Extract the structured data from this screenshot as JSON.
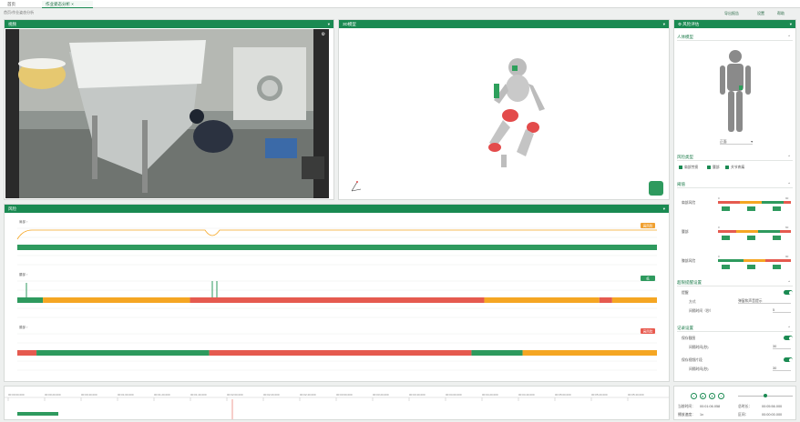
{
  "tabs": [
    {
      "label": "首页",
      "active": false
    },
    {
      "label": "作业姿态分析 ×",
      "active": true
    }
  ],
  "breadcrumb": "首页/作业姿态分析",
  "top_actions": [
    "导出报告",
    "设置",
    "帮助"
  ],
  "video_panel": {
    "title": "视频"
  },
  "model_panel": {
    "title": "3D模型"
  },
  "timeline_panel": {
    "title": "风险"
  },
  "right_panel": {
    "title": "风险评估",
    "body_section": {
      "title": "人体模型",
      "select_value": "正面"
    },
    "risk_section": {
      "title": "风险类型",
      "checks": [
        "肩部劳损",
        "腰部",
        "关节疼痛"
      ]
    },
    "threshold_section": {
      "title": "阈值",
      "groups": [
        {
          "label": "肩部风险",
          "scale_low": "0",
          "scale_high": "90"
        },
        {
          "label": "腰部",
          "scale_low": "0",
          "scale_high": "60"
        },
        {
          "label": "膝部风险",
          "scale_low": "0",
          "scale_high": "90"
        }
      ]
    },
    "alert_section": {
      "title": "超限提醒设置",
      "toggle_label": "提醒",
      "field1_label": "方式",
      "field1_value": "弹窗和声音提示",
      "field2_label": "间隔时间（秒）",
      "field2_value": "5"
    },
    "record_section": {
      "title": "记录设置",
      "item1": "保存截图",
      "item1_sub": "间隔时间(秒)",
      "item1_value": "30",
      "item2": "保存视频片段",
      "item2_sub": "间隔时间(秒)",
      "item2_value": "30"
    }
  },
  "tracks": [
    {
      "label": "肩部 ↑",
      "badge": "高风险",
      "badge_color": "#f0a030"
    },
    {
      "label": "腰部 ↑",
      "badge": "低",
      "badge_color": "#2e9a5e"
    },
    {
      "label": "膝部 ↑",
      "badge": "高风险",
      "badge_color": "#e85a4f"
    }
  ],
  "ticks": [
    "00:00:00.000",
    "00:00:20.000",
    "00:00:40.000",
    "00:01:00.000",
    "00:01:20.000",
    "00:01:40.000",
    "00:02:00.000",
    "00:02:20.000",
    "00:02:40.000",
    "00:03:00.000",
    "00:03:20.000",
    "00:03:40.000",
    "00:04:00.000",
    "00:04:20.000",
    "00:04:40.000",
    "00:05:00.000",
    "00:05:20.000",
    "00:05:40.000"
  ],
  "player": {
    "time1_label": "当前时间：",
    "time1_value": "00:01:06.058",
    "time2_label": "总时长：",
    "time2_value": "00:05:56.000",
    "speed_label": "播放速度：",
    "speed_value": "1x",
    "range_label": "区间：",
    "range_value": "00:00:00.000"
  },
  "colors": {
    "green": "#2e9a5e",
    "orange": "#f5a623",
    "red": "#e55a4f",
    "brand": "#1a8a52"
  }
}
